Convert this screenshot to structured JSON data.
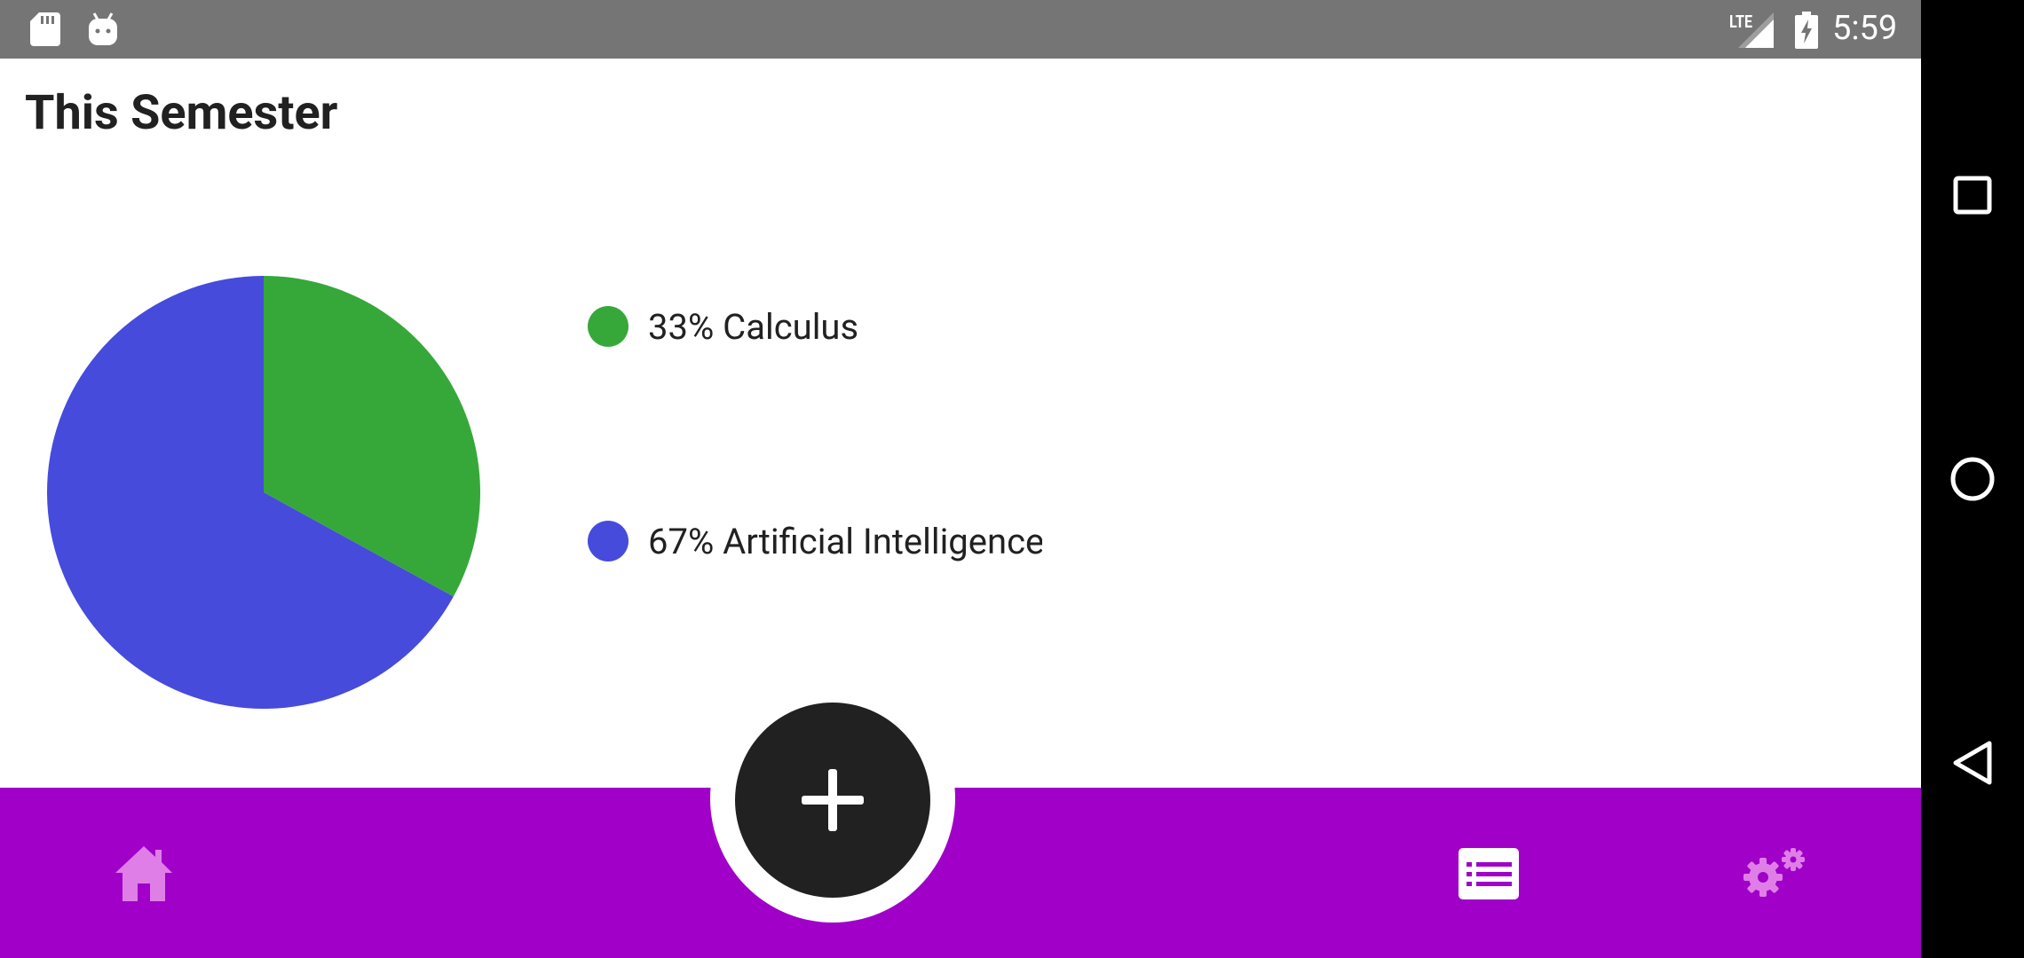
{
  "status_bar": {
    "time": "5:59",
    "network": "LTE",
    "icons": [
      "sd-card-icon",
      "android-debug-icon",
      "signal-icon",
      "battery-charging-icon"
    ]
  },
  "header": {
    "title": "This Semester"
  },
  "chart_data": {
    "type": "pie",
    "slices": [
      {
        "label": "Calculus",
        "value": 33,
        "color": "#36a83a"
      },
      {
        "label": "Artificial Intelligence",
        "value": 67,
        "color": "#464bdc"
      }
    ]
  },
  "legend": [
    {
      "text": "33% Calculus",
      "color": "#36a83a"
    },
    {
      "text": "67% Artificial Intelligence",
      "color": "#464bdc"
    }
  ],
  "bottom_bar": {
    "color": "#a000c8",
    "items": [
      {
        "icon": "home-icon"
      },
      {
        "icon": "add-icon"
      },
      {
        "icon": "list-icon"
      },
      {
        "icon": "settings-icon"
      }
    ]
  },
  "system_nav": {
    "icons": [
      "recents-icon",
      "home-circle-icon",
      "back-icon"
    ]
  }
}
